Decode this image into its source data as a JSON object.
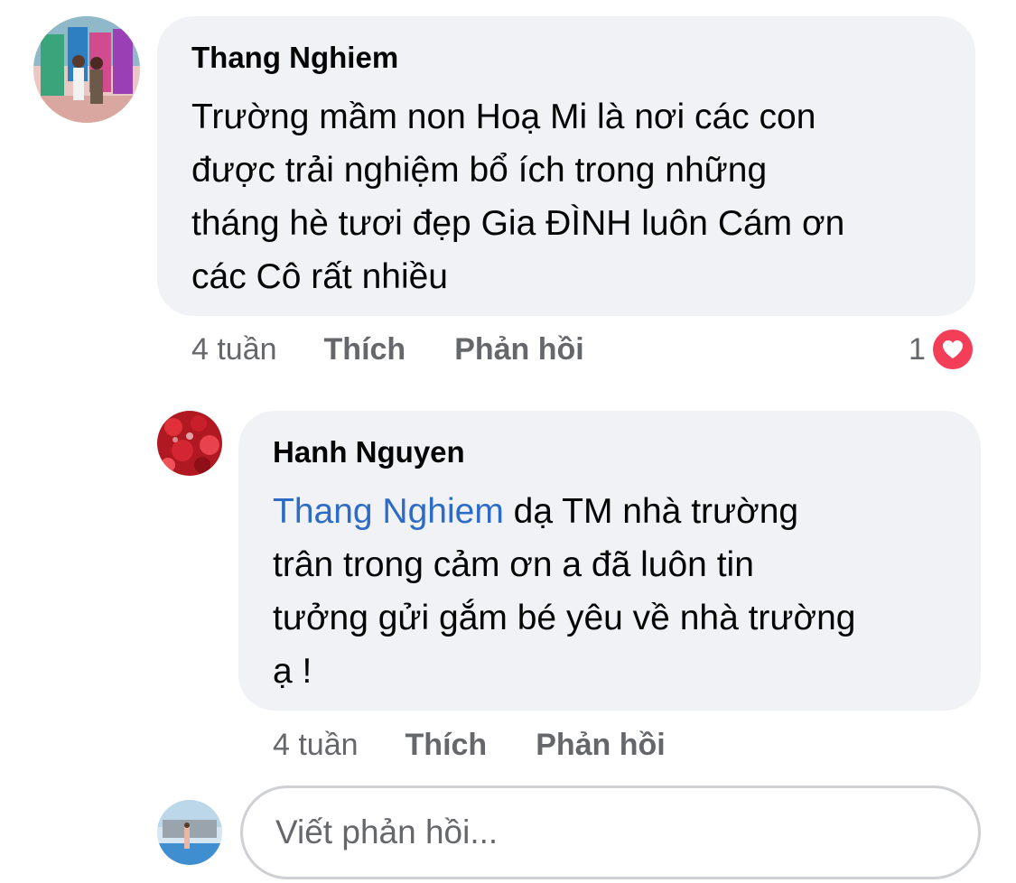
{
  "comments": [
    {
      "author": "Thang Nghiem",
      "lines": [
        "Trường mầm non Hoạ Mi là nơi các con",
        "được trải nghiệm bổ ích trong những",
        "tháng hè tươi đẹp Gia ĐÌNH luôn Cám ơn",
        "các Cô rất nhiều"
      ],
      "time": "4 tuần",
      "like_label": "Thích",
      "reply_label": "Phản hồi",
      "reaction_count": "1",
      "reaction_icon": "heart-icon",
      "reaction_color": "#f33e58"
    }
  ],
  "reply": {
    "author": "Hanh Nguyen",
    "mention": "Thang Nghiem",
    "line1_rest": " dạ TM nhà trường",
    "lines": [
      "trân trong  cảm ơn a đã luôn tin",
      "tưởng gửi gắm bé yêu về nhà trường",
      "ạ !"
    ],
    "time": "4 tuần",
    "like_label": "Thích",
    "reply_label": "Phản hồi"
  },
  "reply_input": {
    "placeholder": "Viết phản hồi..."
  },
  "colors": {
    "bubble_bg": "#f0f2f5",
    "mention": "#2d6cc6",
    "meta_text": "#65676b"
  }
}
